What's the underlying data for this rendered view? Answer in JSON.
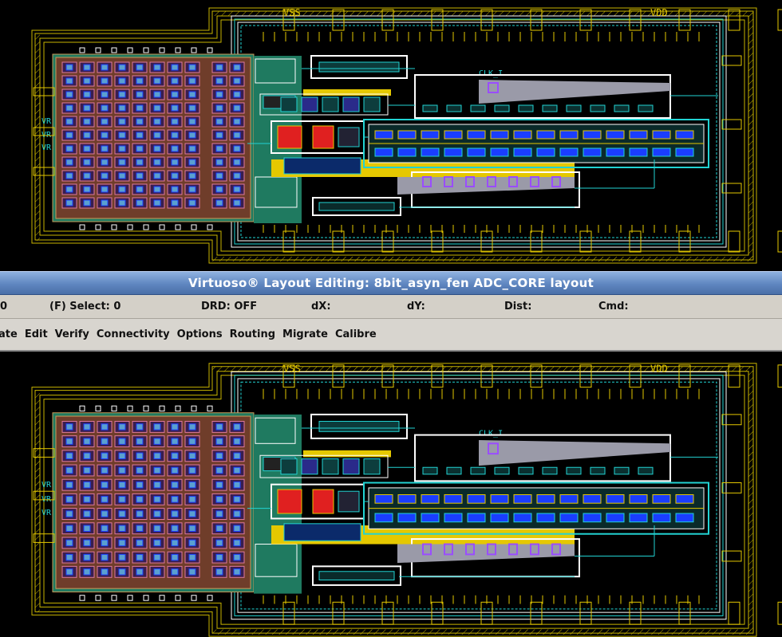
{
  "window": {
    "title": "Virtuoso® Layout Editing: 8bit_asyn_fen ADC_CORE layout"
  },
  "status": {
    "left_value": "0",
    "select_label": "(F) Select: 0",
    "drd_label": "DRD: OFF",
    "dx_label": "dX:",
    "dy_label": "dY:",
    "dist_label": "Dist:",
    "cmd_label": "Cmd:"
  },
  "menu": {
    "items": [
      "ate",
      "Edit",
      "Verify",
      "Connectivity",
      "Options",
      "Routing",
      "Migrate",
      "Calibre"
    ]
  },
  "layout_pins": {
    "vss": "VSS",
    "vdd": "VDD",
    "clk": "CLK_I",
    "vref": "VR"
  },
  "colors": {
    "canvas": "#000000",
    "guard_ring": "#c8b400",
    "metal_cyan": "#22d3d3",
    "array_pink": "#e07a9a",
    "array_tan": "#c99a5a",
    "substrate_green": "#1f7a60",
    "white_outline": "#ffffff",
    "yellow_metal": "#e5c800",
    "violet_via": "#9a4dff",
    "blue_metal": "#1a3dff",
    "grey_poly": "#9a9aa8",
    "red_diff": "#e02020"
  }
}
